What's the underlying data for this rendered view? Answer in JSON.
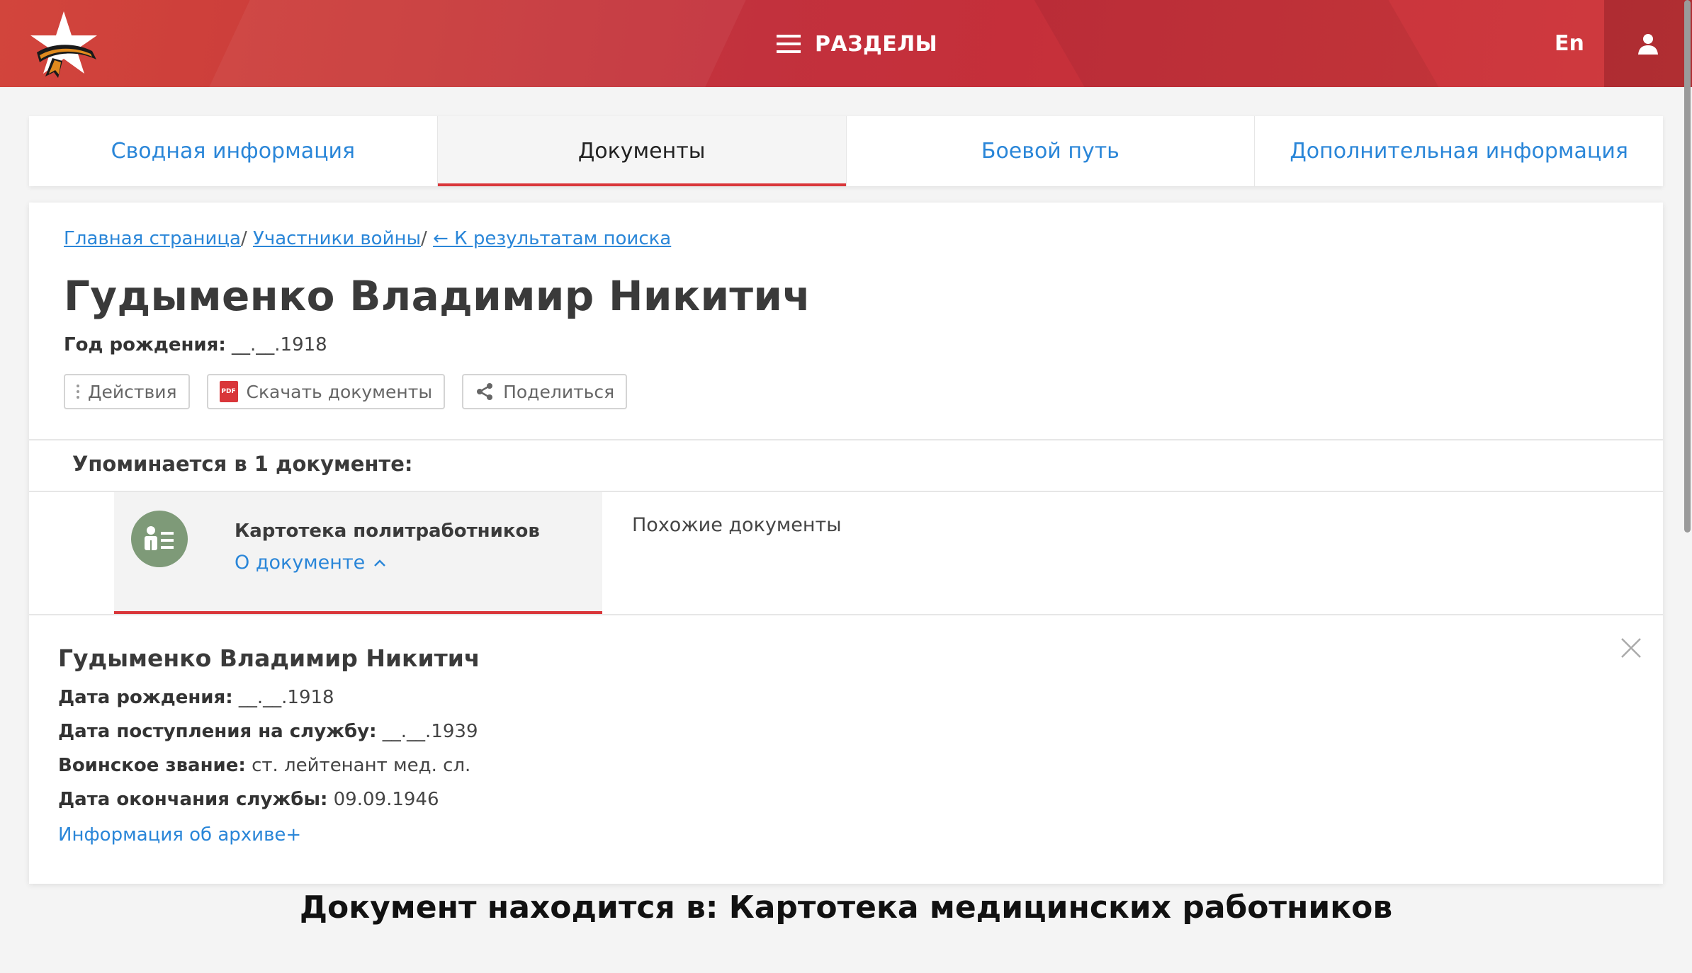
{
  "header": {
    "menu_label": "РАЗДЕЛЫ",
    "lang": "En",
    "logo_icon": "star-ribbon-logo",
    "user_icon": "user-icon"
  },
  "tabs": [
    {
      "label": "Сводная информация",
      "active": false
    },
    {
      "label": "Документы",
      "active": true
    },
    {
      "label": "Боевой путь",
      "active": false
    },
    {
      "label": "Дополнительная информация",
      "active": false
    }
  ],
  "breadcrumb": {
    "home": "Главная страница",
    "participants": "Участники войны",
    "back": "← К результатам поиска",
    "sep": "/"
  },
  "person": {
    "name": "Гудыменко Владимир Никитич",
    "birth_label": "Год рождения:",
    "birth_value": "__.__.1918"
  },
  "actions": {
    "actions_label": "Действия",
    "download_label": "Скачать документы",
    "share_label": "Поделиться",
    "pdf_badge": "PDF"
  },
  "mentions": "Упоминается в 1 документе:",
  "document": {
    "title": "Картотека политработников",
    "about_link": "О документе",
    "similar": "Похожие документы"
  },
  "details": {
    "name": "Гудыменко Владимир Никитич",
    "rows": [
      {
        "label": "Дата рождения:",
        "value": "__.__.1918"
      },
      {
        "label": "Дата поступления на службу:",
        "value": "__.__.1939"
      },
      {
        "label": "Воинское звание:",
        "value": "ст. лейтенант мед. сл."
      },
      {
        "label": "Дата окончания службы:",
        "value": "09.09.1946"
      }
    ],
    "archive_link": "Информация об архиве+"
  },
  "footer_note": "Документ находится в: Картотека медицинских работников",
  "colors": {
    "accent_red": "#d9363a",
    "link_blue": "#2a86d8",
    "doc_icon_green": "#7e9a78"
  }
}
